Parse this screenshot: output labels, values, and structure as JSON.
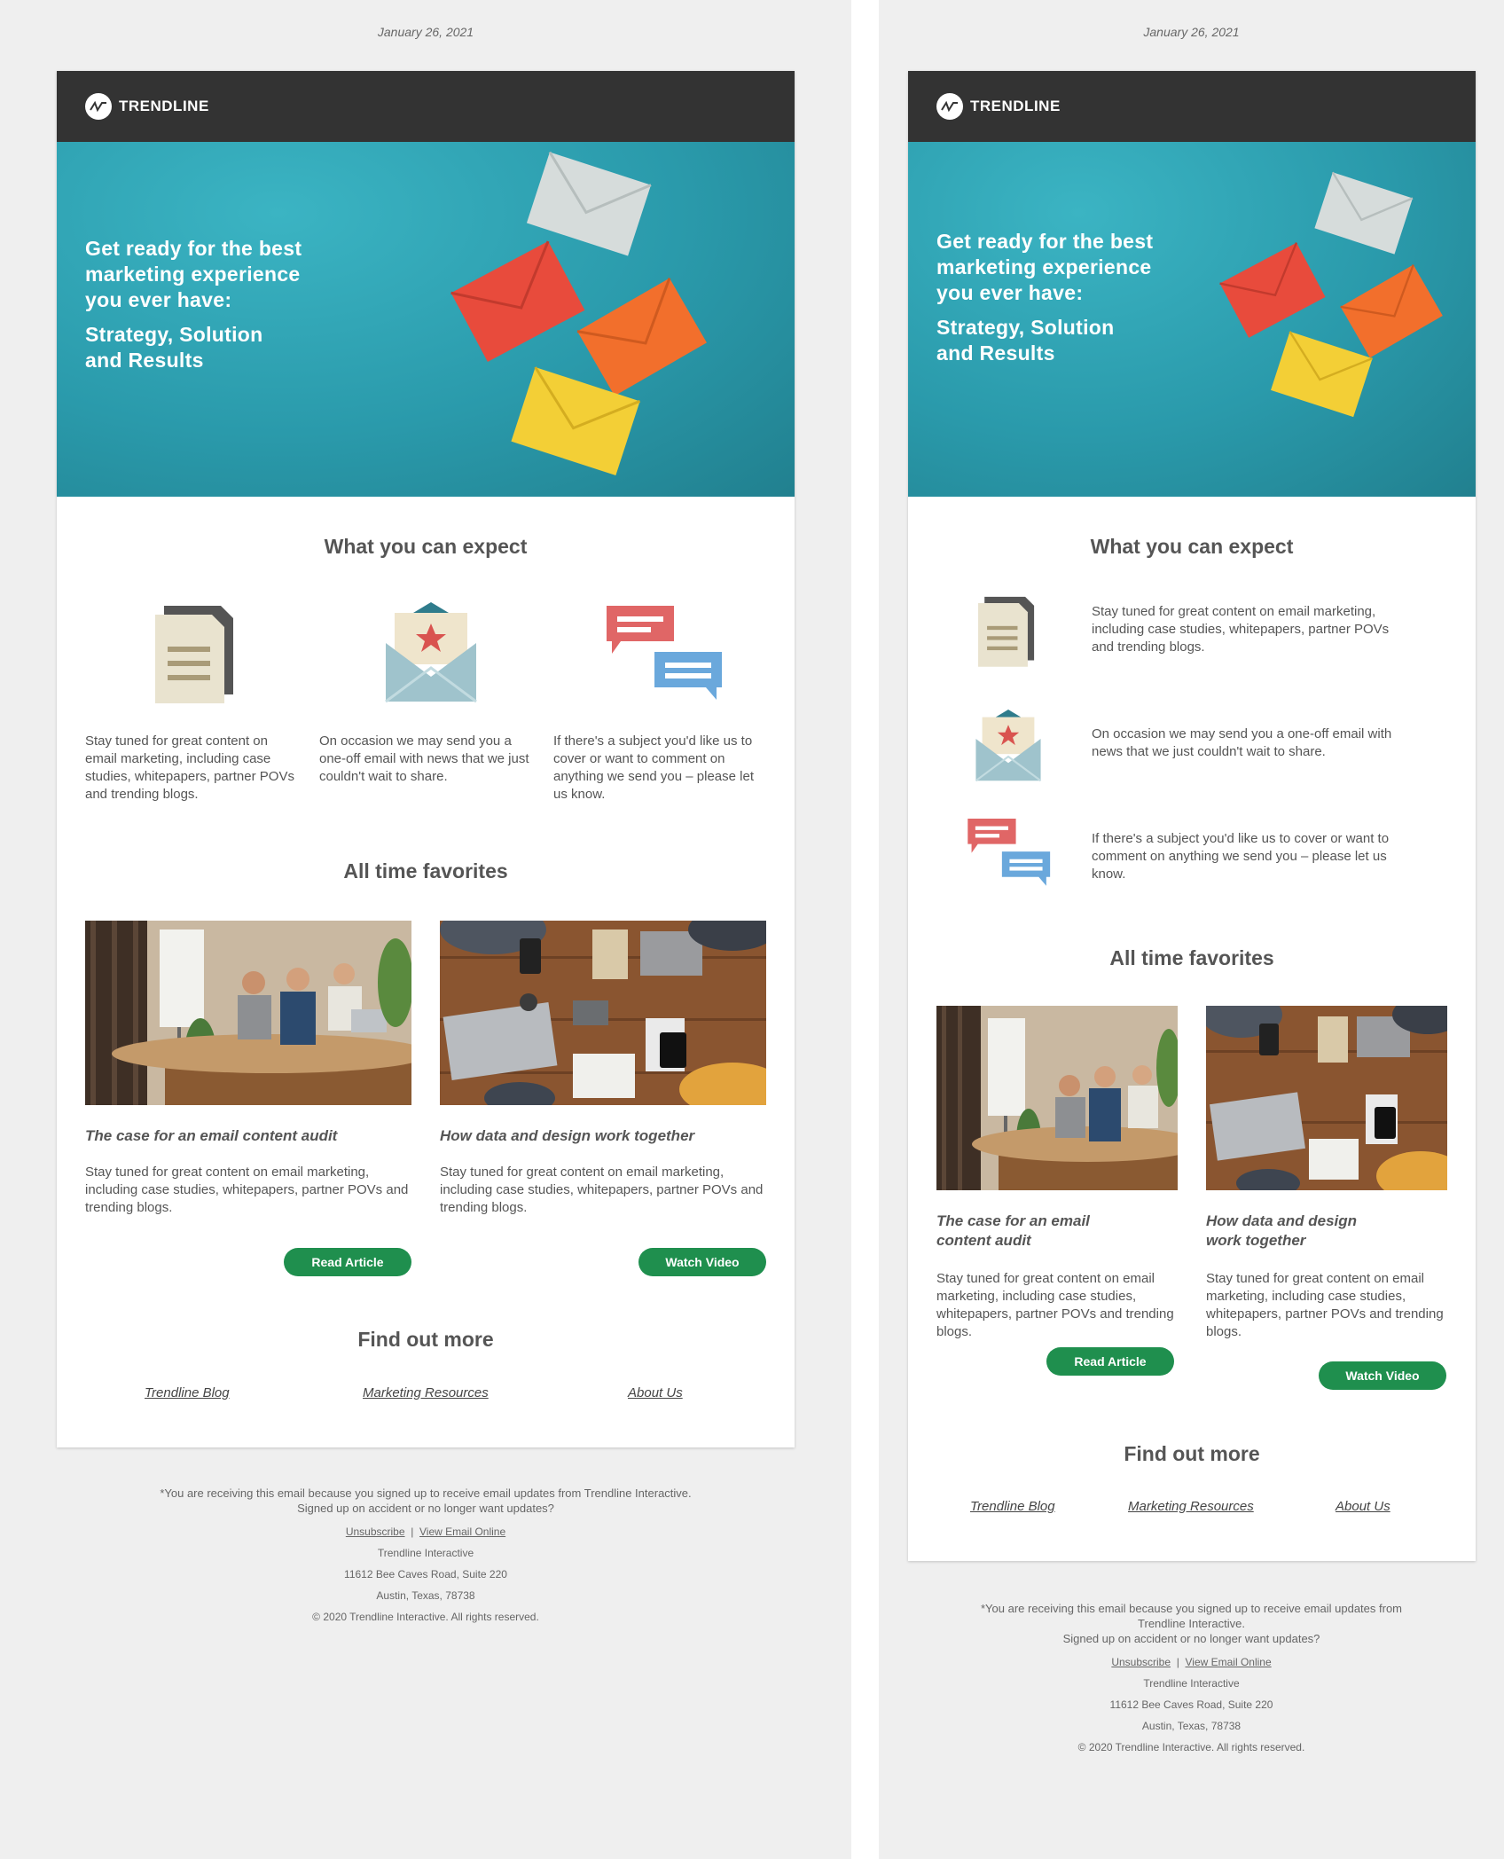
{
  "date": "January 26, 2021",
  "brand": {
    "name": "TRENDLINE"
  },
  "hero": {
    "lines": [
      "Get ready for the best",
      "marketing experience",
      "you ever have:"
    ],
    "lines2": [
      "Strategy, Solution",
      "and Results"
    ],
    "mobile_lines": [
      "Get ready for the best",
      "marketing experience",
      "you ever have:"
    ],
    "mobile_lines2": [
      "Strategy, Solution",
      "and Results"
    ]
  },
  "expect": {
    "title": "What you can expect",
    "items": [
      {
        "icon": "document-icon",
        "text": "Stay tuned for great content on email marketing, including case studies, whitepapers, partner POVs and trending blogs."
      },
      {
        "icon": "envelope-star-icon",
        "text": "On occasion we may send you a one-off email with news that we just couldn't wait to share."
      },
      {
        "icon": "chat-bubbles-icon",
        "text": "If there's a subject you'd like us to cover or want to comment on anything we send you – please let us know."
      }
    ]
  },
  "favorites": {
    "title": "All time favorites",
    "articles": [
      {
        "title": "The case for an email content audit",
        "text": "Stay tuned for great content on email marketing, including case studies, whitepapers, partner POVs and trending blogs.",
        "button": "Read Article"
      },
      {
        "title": "How data and design work together",
        "text": "Stay tuned for great content on email marketing, including case studies, whitepapers, partner POVs and trending blogs.",
        "button": "Watch Video"
      }
    ]
  },
  "findout": {
    "title": "Find out more",
    "links": [
      "Trendline Blog",
      "Marketing Resources",
      "About Us"
    ]
  },
  "footer": {
    "notice": "*You are receiving this email because you signed up to receive email updates from Trendline Interactive.",
    "notice2": "Signed up on accident or no longer want updates?",
    "unsubscribe": "Unsubscribe",
    "separator": "|",
    "view_online": "View Email Online",
    "company": "Trendline Interactive",
    "address": "11612 Bee Caves Road, Suite 220",
    "city": "Austin, Texas, 78738",
    "copyright": "© 2020 Trendline Interactive. All rights reserved."
  },
  "colors": {
    "accent": "#1f8f4e",
    "header": "#333333",
    "hero": "#2a9aab"
  }
}
